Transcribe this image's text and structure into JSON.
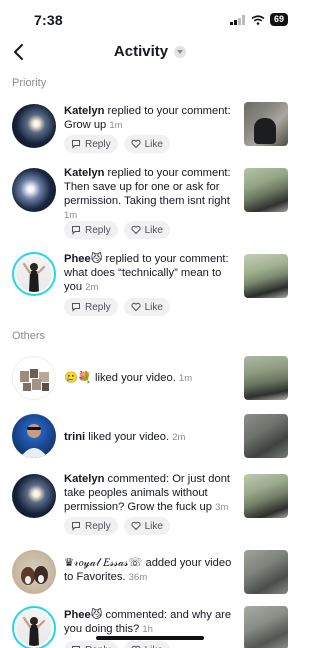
{
  "status_bar": {
    "time": "7:38",
    "battery": "69"
  },
  "header": {
    "title": "Activity"
  },
  "sections": {
    "priority": "Priority",
    "others": "Others"
  },
  "actions": {
    "reply": "Reply",
    "like": "Like"
  },
  "notifications": [
    {
      "user": "Katelyn",
      "text": " replied to your comment: Grow up",
      "time": "1m"
    },
    {
      "user": "Katelyn",
      "text": " replied to your comment: Then save up for one or ask for permission. Taking them isnt right",
      "time": "1m"
    },
    {
      "user": "Phee😼",
      "text": " replied to your comment: what does “technically” mean to you",
      "time": "2m"
    },
    {
      "user": "",
      "text": "🥲💐 liked your video.",
      "time": "1m"
    },
    {
      "user": "trini",
      "text": " liked your video.",
      "time": "2m"
    },
    {
      "user": "Katelyn",
      "text": " commented: Or just dont take peoples animals without permission? Grow the fuck up",
      "time": "3m"
    },
    {
      "user": "",
      "text": "♛𝓇𝑜𝓎𝒶𝓁 𝐸𝓈𝓈𝒶𝓈☏ added your video to Favorites.",
      "time": "36m"
    },
    {
      "user": "Phee😼",
      "text": " commented: and why are you doing this?",
      "time": "1h"
    }
  ],
  "icons": {
    "back": "chevron-left-icon",
    "dropdown": "chevron-down-icon",
    "reply": "reply-bubble-icon",
    "like": "heart-outline-icon",
    "signal": "signal-icon",
    "wifi": "wifi-icon",
    "battery": "battery-icon"
  },
  "colors": {
    "story_ring": "#20d5ec",
    "muted_text": "#8a8b91",
    "pill_bg": "#f1f1f2"
  }
}
